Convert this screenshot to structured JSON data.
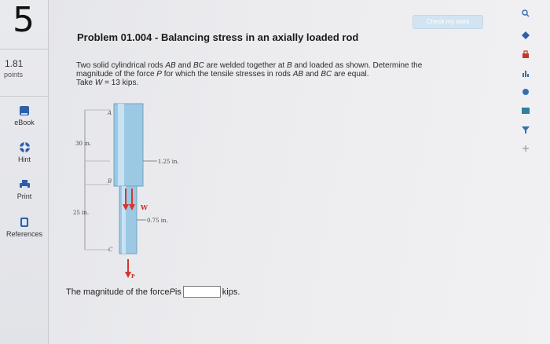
{
  "question": {
    "number": "5",
    "score_value": "1.81",
    "score_unit": "points"
  },
  "tools": [
    {
      "label": "eBook",
      "icon": "ebook-icon"
    },
    {
      "label": "Hint",
      "icon": "hint-icon"
    },
    {
      "label": "Print",
      "icon": "print-icon"
    },
    {
      "label": "References",
      "icon": "references-icon"
    }
  ],
  "check_button": {
    "label": "Check my work"
  },
  "problem": {
    "title": "Problem 01.004 - Balancing stress in an axially loaded rod",
    "line1_a": "Two solid cylindrical rods ",
    "line1_ab": "AB",
    "line1_b": " and ",
    "line1_bc": "BC",
    "line1_c": " are welded together at ",
    "line1_B": "B",
    "line1_d": " and loaded as shown. Determine the",
    "line2_a": "magnitude of the force ",
    "line2_P": "P",
    "line2_b": " for which the tensile stresses in rods ",
    "line2_ab": "AB",
    "line2_c": " and ",
    "line2_bc": "BC",
    "line2_d": " are equal.",
    "line3_a": "Take ",
    "line3_W": "W",
    "line3_b": " = 13 kips."
  },
  "diagram": {
    "label_A": "A",
    "label_B": "B",
    "label_C": "C",
    "label_W": "W",
    "label_P": "P",
    "dim_upper_length": "30 in.",
    "dim_lower_length": "25 in.",
    "dim_upper_diameter": "1.25 in.",
    "dim_lower_diameter": "0.75 in."
  },
  "answer": {
    "prefix": "The magnitude of the force ",
    "var": "P",
    "mid": " is",
    "unit": "kips.",
    "value": ""
  },
  "colors": {
    "rod": "#9cc8e4",
    "arrow": "#d9352b",
    "check_button": "#d2e4f1"
  }
}
